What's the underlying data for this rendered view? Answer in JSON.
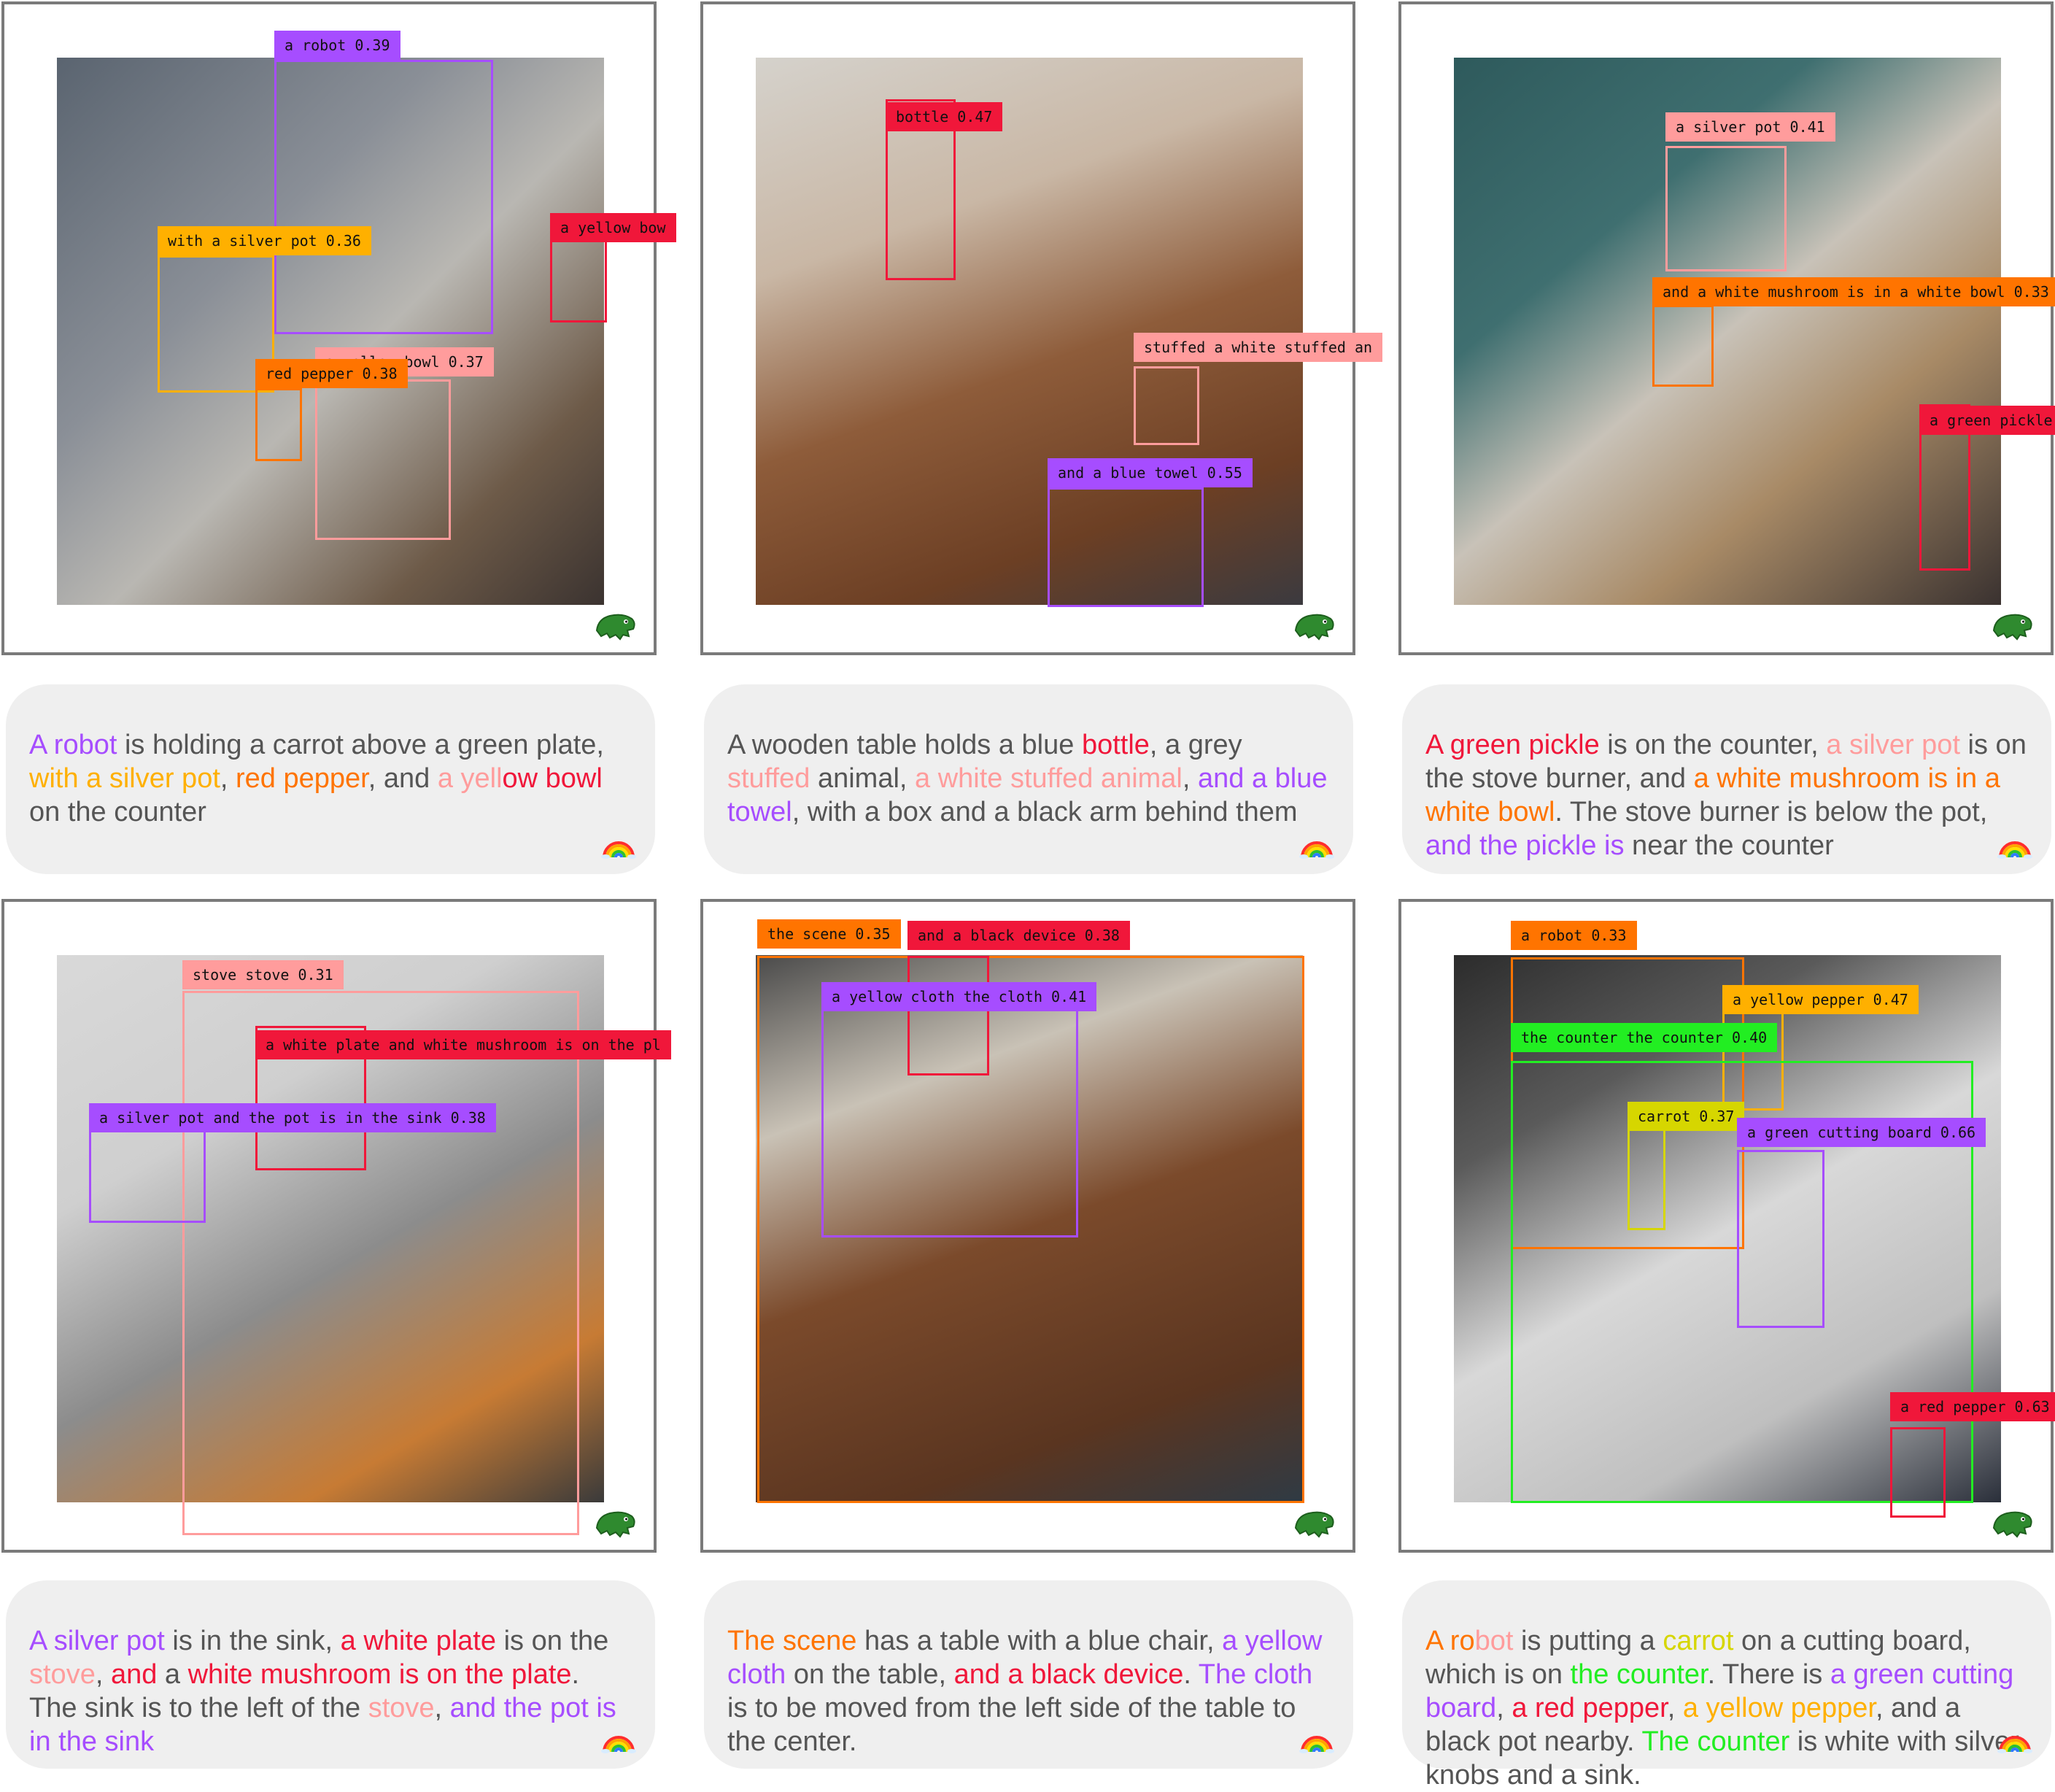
{
  "panels": [
    {
      "photo": "kitchen",
      "detections": [
        {
          "label": "a robot 0.39",
          "color": "#a64dff"
        },
        {
          "label": "with a silver pot 0.36",
          "color": "#ffb000"
        },
        {
          "label": "a yellow bow",
          "color": "#f0173a"
        },
        {
          "label": "a yellow bowl 0.37",
          "color": "#ff9c9c"
        },
        {
          "label": "red pepper 0.38",
          "color": "#ff7400"
        }
      ],
      "caption": [
        {
          "t": "A robot",
          "c": "#a64dff"
        },
        {
          "t": " is holding a carrot above a green plate, ",
          "c": "#555555"
        },
        {
          "t": "with a silver pot",
          "c": "#ffb000"
        },
        {
          "t": ", ",
          "c": "#555555"
        },
        {
          "t": "red pepper",
          "c": "#ff7400"
        },
        {
          "t": ", and ",
          "c": "#555555"
        },
        {
          "t": "a yell",
          "c": "#ff9c9c"
        },
        {
          "t": "ow bowl",
          "c": "#f0173a"
        },
        {
          "t": " on the counter",
          "c": "#555555"
        }
      ]
    },
    {
      "photo": "table",
      "detections": [
        {
          "label": "bottle 0.47",
          "color": "#f0173a"
        },
        {
          "label": "stuffed a white stuffed an",
          "color": "#ff9c9c"
        },
        {
          "label": "and a blue towel 0.55",
          "color": "#a64dff"
        }
      ],
      "caption": [
        {
          "t": "A wooden table holds a blue ",
          "c": "#555555"
        },
        {
          "t": "bottle",
          "c": "#f0173a"
        },
        {
          "t": ", a grey ",
          "c": "#555555"
        },
        {
          "t": "stuffed",
          "c": "#ff9c9c"
        },
        {
          "t": " animal, ",
          "c": "#555555"
        },
        {
          "t": "a white stuffed animal",
          "c": "#ff9c9c"
        },
        {
          "t": ", ",
          "c": "#555555"
        },
        {
          "t": "and a blue towel",
          "c": "#a64dff"
        },
        {
          "t": ", with a box and a black arm behind them",
          "c": "#555555"
        }
      ]
    },
    {
      "photo": "stove",
      "detections": [
        {
          "label": "a silver pot 0.41",
          "color": "#ff9c9c"
        },
        {
          "label": "and a white mushroom is in a white bowl 0.33",
          "color": "#ff7400"
        },
        {
          "label": "a green pickle",
          "color": "#f0173a"
        }
      ],
      "caption": [
        {
          "t": "A green pickle",
          "c": "#f0173a"
        },
        {
          "t": " is on the counter, ",
          "c": "#555555"
        },
        {
          "t": "a silver pot",
          "c": "#ff9c9c"
        },
        {
          "t": " is on the stove burner, and ",
          "c": "#555555"
        },
        {
          "t": "a white mushroom is in a white bowl",
          "c": "#ff7400"
        },
        {
          "t": ". The stove burner is below the pot, ",
          "c": "#555555"
        },
        {
          "t": "and the pickle is",
          "c": "#a64dff"
        },
        {
          "t": " near the counter",
          "c": "#555555"
        }
      ]
    },
    {
      "photo": "stove2",
      "detections": [
        {
          "label": "stove stove 0.31",
          "color": "#ff9c9c"
        },
        {
          "label": "a white plate and white mushroom is on the pl",
          "color": "#f0173a"
        },
        {
          "label": "a silver pot and the pot is in the sink 0.38",
          "color": "#a64dff"
        }
      ],
      "caption": [
        {
          "t": "A silver pot",
          "c": "#a64dff"
        },
        {
          "t": " is in the sink, ",
          "c": "#555555"
        },
        {
          "t": "a white plate",
          "c": "#f0173a"
        },
        {
          "t": " is on the ",
          "c": "#555555"
        },
        {
          "t": "stove",
          "c": "#ff9c9c"
        },
        {
          "t": ", ",
          "c": "#555555"
        },
        {
          "t": "and",
          "c": "#f0173a"
        },
        {
          "t": " a ",
          "c": "#555555"
        },
        {
          "t": "white mushroom is on the plate",
          "c": "#f0173a"
        },
        {
          "t": ". The sink is to the left of the ",
          "c": "#555555"
        },
        {
          "t": "stove",
          "c": "#ff9c9c"
        },
        {
          "t": ", ",
          "c": "#555555"
        },
        {
          "t": "and the pot is in the sink",
          "c": "#a64dff"
        }
      ]
    },
    {
      "photo": "wood",
      "detections": [
        {
          "label": "the scene 0.35",
          "color": "#ff7400"
        },
        {
          "label": "and a black device 0.38",
          "color": "#f0173a"
        },
        {
          "label": "a yellow cloth the cloth 0.41",
          "color": "#a64dff"
        }
      ],
      "caption": [
        {
          "t": "The scene",
          "c": "#ff7400"
        },
        {
          "t": " has a table with a blue chair, ",
          "c": "#555555"
        },
        {
          "t": "a yellow cloth",
          "c": "#a64dff"
        },
        {
          "t": " on the table, ",
          "c": "#555555"
        },
        {
          "t": "and a black device",
          "c": "#f0173a"
        },
        {
          "t": ". ",
          "c": "#555555"
        },
        {
          "t": "The cloth",
          "c": "#a64dff"
        },
        {
          "t": " is to be moved from the left side of the table to the center.",
          "c": "#555555"
        }
      ]
    },
    {
      "photo": "kitchen2",
      "detections": [
        {
          "label": "a robot 0.33",
          "color": "#ff7400"
        },
        {
          "label": "a yellow pepper 0.47",
          "color": "#ffb000"
        },
        {
          "label": "the counter the counter 0.40",
          "color": "#22ee22"
        },
        {
          "label": "carrot 0.37",
          "color": "#d6d600"
        },
        {
          "label": "a green cutting board 0.66",
          "color": "#a64dff"
        },
        {
          "label": "a red pepper 0.63",
          "color": "#f0173a"
        }
      ],
      "caption": [
        {
          "t": "A ro",
          "c": "#ff7400"
        },
        {
          "t": "bot",
          "c": "#ff9c9c"
        },
        {
          "t": " is putting a ",
          "c": "#555555"
        },
        {
          "t": "carrot",
          "c": "#d6d600"
        },
        {
          "t": " on a cutting board, which is on ",
          "c": "#555555"
        },
        {
          "t": "the counter",
          "c": "#22ee22"
        },
        {
          "t": ". There is ",
          "c": "#555555"
        },
        {
          "t": "a green cutting board",
          "c": "#a64dff"
        },
        {
          "t": ", ",
          "c": "#555555"
        },
        {
          "t": "a red pepper",
          "c": "#f0173a"
        },
        {
          "t": ", ",
          "c": "#555555"
        },
        {
          "t": "a yellow pepper",
          "c": "#ffb000"
        },
        {
          "t": ", and a black pot nearby. ",
          "c": "#555555"
        },
        {
          "t": "The counter",
          "c": "#22ee22"
        },
        {
          "t": " is white with silver knobs and a sink.",
          "c": "#555555"
        }
      ]
    }
  ]
}
